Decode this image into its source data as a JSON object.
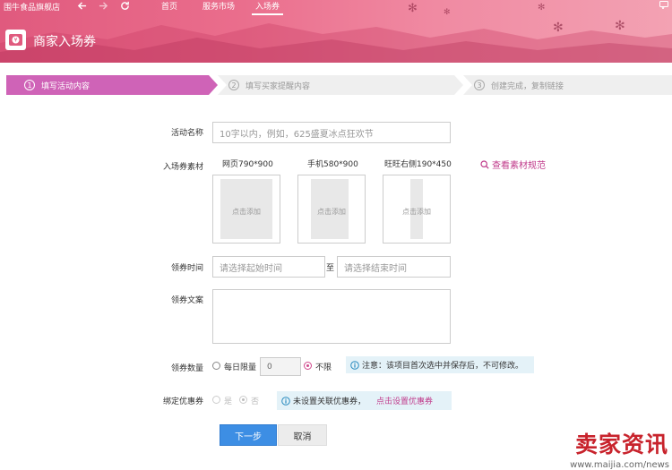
{
  "topbar": {
    "shop_name": "围牛食品旗舰店",
    "nav": [
      {
        "label": "首页",
        "active": false
      },
      {
        "label": "服务市场",
        "active": false
      },
      {
        "label": "入场券",
        "active": true
      }
    ]
  },
  "app": {
    "title": "商家入场券"
  },
  "colors": {
    "accent": "#c03b8b",
    "step_active": "#cf63b7",
    "primary_button": "#3d8ee4",
    "header_start": "#e05a7e",
    "notice_bg": "#e4f2f8"
  },
  "steps": [
    {
      "num": "1",
      "label": "填写活动内容",
      "active": true
    },
    {
      "num": "2",
      "label": "填写买家提醒内容",
      "active": false
    },
    {
      "num": "3",
      "label": "创建完成，复制链接",
      "active": false
    }
  ],
  "form": {
    "name": {
      "label": "活动名称",
      "placeholder": "10字以内，例如，625盛夏冰点狂欢节"
    },
    "material": {
      "label": "入场券素材",
      "columns": [
        {
          "head": "网页790*900",
          "upload_label": "点击添加"
        },
        {
          "head": "手机580*900",
          "upload_label": "点击添加"
        },
        {
          "head": "旺旺右侧190*450",
          "upload_label": "点击添加"
        }
      ],
      "spec_link": "查看素材规范",
      "spec_icon": "search-icon"
    },
    "time": {
      "label": "领券时间",
      "start_placeholder": "请选择起始时间",
      "separator": "至",
      "end_placeholder": "请选择结束时间"
    },
    "copy": {
      "label": "领券文案"
    },
    "quantity": {
      "label": "领券数量",
      "daily_limit": "每日限量",
      "daily_value": "0",
      "unlimited": "不限",
      "selected": "unlimited",
      "notice": "注意：该项目首次选中并保存后，不可修改。"
    },
    "coupon": {
      "label": "绑定优惠券",
      "yes": "是",
      "no": "否",
      "selected": "no",
      "notice": "未设置关联优惠券，",
      "notice_link": "点击设置优惠券"
    }
  },
  "buttons": {
    "next": "下一步",
    "cancel": "取消"
  },
  "watermark": {
    "title": "卖家资讯",
    "url": "www.maijia.com/news"
  }
}
